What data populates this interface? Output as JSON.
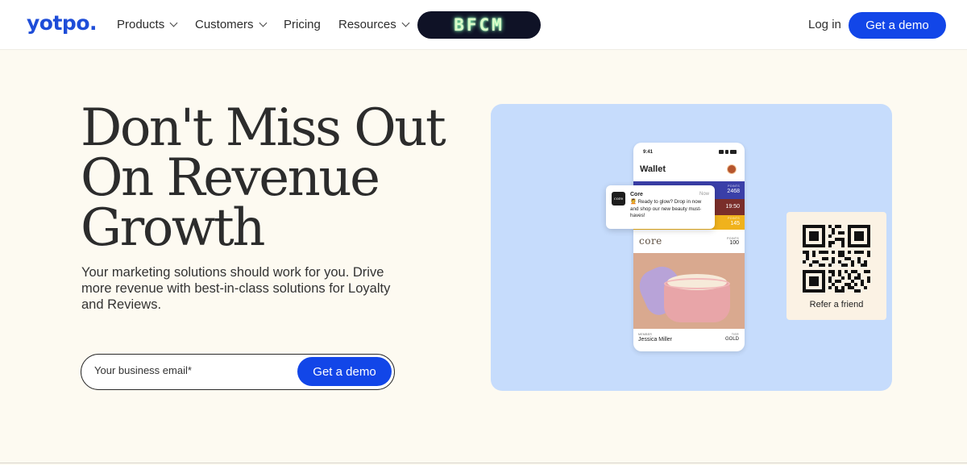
{
  "nav": {
    "logo": "yotpo.",
    "items": [
      {
        "label": "Products",
        "has_dropdown": true
      },
      {
        "label": "Customers",
        "has_dropdown": true
      },
      {
        "label": "Pricing",
        "has_dropdown": false
      },
      {
        "label": "Resources",
        "has_dropdown": true
      }
    ],
    "promo_label": "BFCM",
    "login_label": "Log in",
    "demo_label": "Get a demo"
  },
  "hero": {
    "headline_lines": [
      "Don't Miss Out",
      "On Revenue",
      "Growth"
    ],
    "subtext": "Your marketing solutions should work for you. Drive more revenue with best-in-class solutions for Loyalty and Reviews.",
    "email_placeholder": "Your business email*",
    "demo_label": "Get a demo"
  },
  "illustration": {
    "phone": {
      "time": "9:41",
      "title": "Wallet",
      "bands": [
        {
          "label": "POINTS",
          "value": "2468",
          "color": "#3a3fa8"
        },
        {
          "label": "",
          "value": "19:50",
          "color": "#7a2e2a"
        },
        {
          "label": "POINTS",
          "value": "145",
          "color": "#f0b21c"
        }
      ],
      "card": {
        "brand": "core",
        "points_label": "POINTS",
        "points_value": "100",
        "member_label": "MEMBER",
        "member_name": "Jessica Miller",
        "tier_label": "TIER",
        "tier_value": "GOLD"
      }
    },
    "notification": {
      "icon_text": "core",
      "title": "Core",
      "time": "Now",
      "body": "💆 Ready to glow? Drop in now and shop our new beauty must-haves!"
    },
    "qr_card": {
      "label": "Refer a friend"
    }
  },
  "colors": {
    "brand_blue": "#1246e8",
    "logo_blue": "#1e4dd8",
    "page_bg": "#fdfaf1",
    "illustration_bg": "#c6dcfc"
  }
}
